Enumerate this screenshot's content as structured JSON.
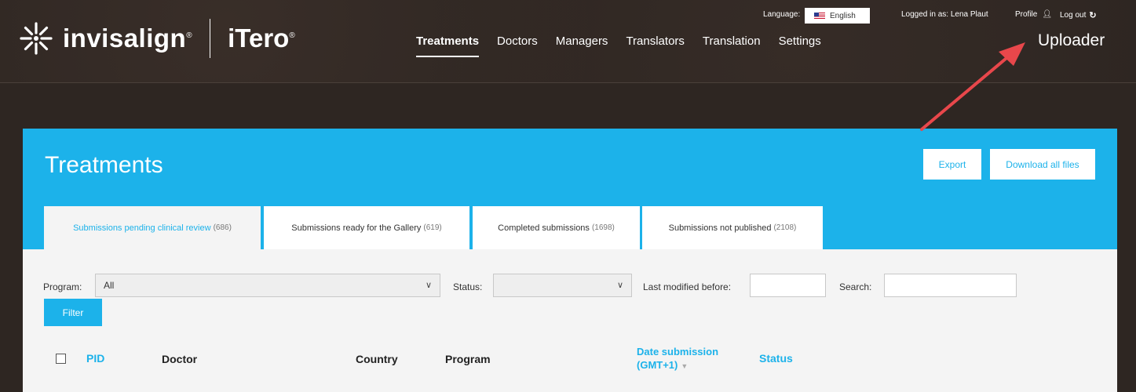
{
  "brand": {
    "invisalign": "invisalign",
    "invisalign_reg": "®",
    "itero": "iTero",
    "itero_reg": "®"
  },
  "nav": {
    "items": [
      {
        "label": "Treatments",
        "active": true
      },
      {
        "label": "Doctors",
        "active": false
      },
      {
        "label": "Managers",
        "active": false
      },
      {
        "label": "Translators",
        "active": false
      },
      {
        "label": "Translation",
        "active": false
      },
      {
        "label": "Settings",
        "active": false
      }
    ]
  },
  "topbar": {
    "language_label": "Language:",
    "language_value": "English",
    "logged_in_label": "Logged in as:",
    "logged_in_user": "Lena Plaut",
    "profile_label": "Profile",
    "logout_label": "Log out",
    "role": "Uploader"
  },
  "page": {
    "title": "Treatments",
    "export_label": "Export",
    "download_label": "Download all files"
  },
  "tabs": [
    {
      "label": "Submissions pending clinical review",
      "count": "(686)",
      "active": true
    },
    {
      "label": "Submissions ready for the Gallery",
      "count": "(619)",
      "active": false
    },
    {
      "label": "Completed submissions",
      "count": "(1698)",
      "active": false
    },
    {
      "label": "Submissions not published",
      "count": "(2108)",
      "active": false
    }
  ],
  "filters": {
    "program_label": "Program:",
    "program_value": "All",
    "status_label": "Status:",
    "status_value": "",
    "last_modified_label": "Last modified before:",
    "search_label": "Search:",
    "filter_button": "Filter"
  },
  "table": {
    "columns": {
      "pid": "PID",
      "doctor": "Doctor",
      "country": "Country",
      "program": "Program",
      "date_line1": "Date submission",
      "date_line2": "(GMT+1)",
      "status": "Status"
    }
  },
  "colors": {
    "accent": "#1cb2ea",
    "header_bg": "#2e2622",
    "content_bg": "#f4f4f4",
    "annotation_arrow": "#e8474b"
  },
  "icons": {
    "brand": "star-icon",
    "flag": "us-flag-icon",
    "profile": "person-icon",
    "logout": "logout-icon",
    "dropdown": "chevron-down-icon",
    "sort": "sort-down-icon",
    "annotation": "arrow-icon"
  }
}
